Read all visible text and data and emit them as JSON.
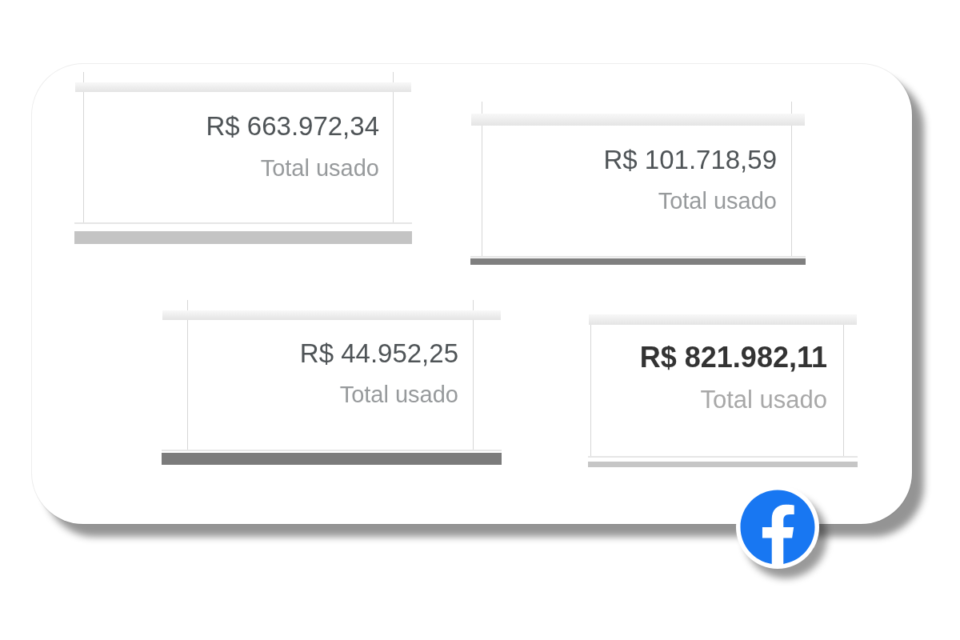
{
  "cards": [
    {
      "amount": "R$ 663.972,34",
      "label": "Total usado",
      "kind": "plain",
      "color": "#c4c4c4"
    },
    {
      "amount": "R$ 101.718,59",
      "label": "Total usado",
      "kind": "plain",
      "color": "#7f7f7f"
    },
    {
      "amount": "R$ 44.952,25",
      "label": "Total usado",
      "kind": "plain",
      "color": "#7b7b7b"
    },
    {
      "amount": "R$ 821.982,11",
      "label": "Total usado",
      "kind": "bold",
      "color": "#c6c6c6"
    }
  ]
}
